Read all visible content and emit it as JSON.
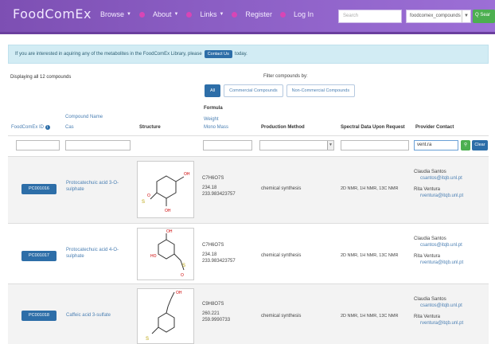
{
  "navbar": {
    "brand": "FoodComEx",
    "menu": [
      {
        "label": "Browse",
        "dropdown": true
      },
      {
        "label": "About",
        "dropdown": true
      },
      {
        "label": "Links",
        "dropdown": true
      },
      {
        "label": "Register",
        "dropdown": false
      },
      {
        "label": "Log In",
        "dropdown": false
      }
    ],
    "search_placeholder": "Search",
    "search_scope": "foodcomex_compounds",
    "search_button": "Q Sear"
  },
  "alert": {
    "text": "If you are interested in aquiring any of the metabolites in the FoodComEx Library, please",
    "button": "Contact Us",
    "suffix": "today."
  },
  "summary": {
    "displaying": "Displaying all 12 compounds",
    "filter_label": "Filter compounds by:",
    "filters": [
      "All",
      "Commercial Compounds",
      "Non-Commercial Compounds"
    ],
    "active_filter": "All"
  },
  "table": {
    "headers": {
      "id": "FoodComEx ID",
      "compound_name": "Compound Name",
      "cas": "Cas",
      "structure": "Structure",
      "formula": "Formula",
      "weight": "Weight",
      "mono_mass": "Mono Mass",
      "production_method": "Production Method",
      "spectral": "Spectral Data Upon Request",
      "provider": "Provider Contact"
    },
    "filter_inputs": {
      "provider_value": "vent.ra",
      "clear_button": "Clear"
    },
    "rows": [
      {
        "id": "PC001016",
        "name": "Protocatechuic acid 3-O-sulphate",
        "formula": "C7H6O7S",
        "weight": "234.18",
        "mono_mass": "233.983423757",
        "method": "chemical synthesis",
        "spectral": "2D NMR, 1H NMR, 13C NMR",
        "contact1_name": "Claudia Santos",
        "contact1_email": "csantos@itqb.unl.pt",
        "contact2_name": "Rita Ventura",
        "contact2_email": "rventura@itqb.unl.pt"
      },
      {
        "id": "PC001017",
        "name": "Protocatechuic acid 4-O-sulphate",
        "formula": "C7H6O7S",
        "weight": "234.18",
        "mono_mass": "233.983423757",
        "method": "chemical synthesis",
        "spectral": "2D NMR, 1H NMR, 13C NMR",
        "contact1_name": "Claudia Santos",
        "contact1_email": "csantos@itqb.unl.pt",
        "contact2_name": "Rita Ventura",
        "contact2_email": "rventura@itqb.unl.pt"
      },
      {
        "id": "PC001018",
        "name": "Caffeic acid 3-sulfate",
        "formula": "C9H8O7S",
        "weight": "260.221",
        "mono_mass": "259.9990733",
        "method": "chemical synthesis",
        "spectral": "2D NMR, 1H NMR, 13C NMR",
        "contact1_name": "Claudia Santos",
        "contact1_email": "csantos@itqb.unl.pt",
        "contact2_name": "Rita Ventura",
        "contact2_email": "rventura@itqb.unl.pt"
      }
    ]
  },
  "colors": {
    "navbar": "#8a5dc3",
    "nav_dot": "#d845b6",
    "primary_button": "#2d6ea8",
    "search_button": "#4caf50",
    "alert_bg": "#d2ecf4",
    "link": "#4a7fb3"
  }
}
